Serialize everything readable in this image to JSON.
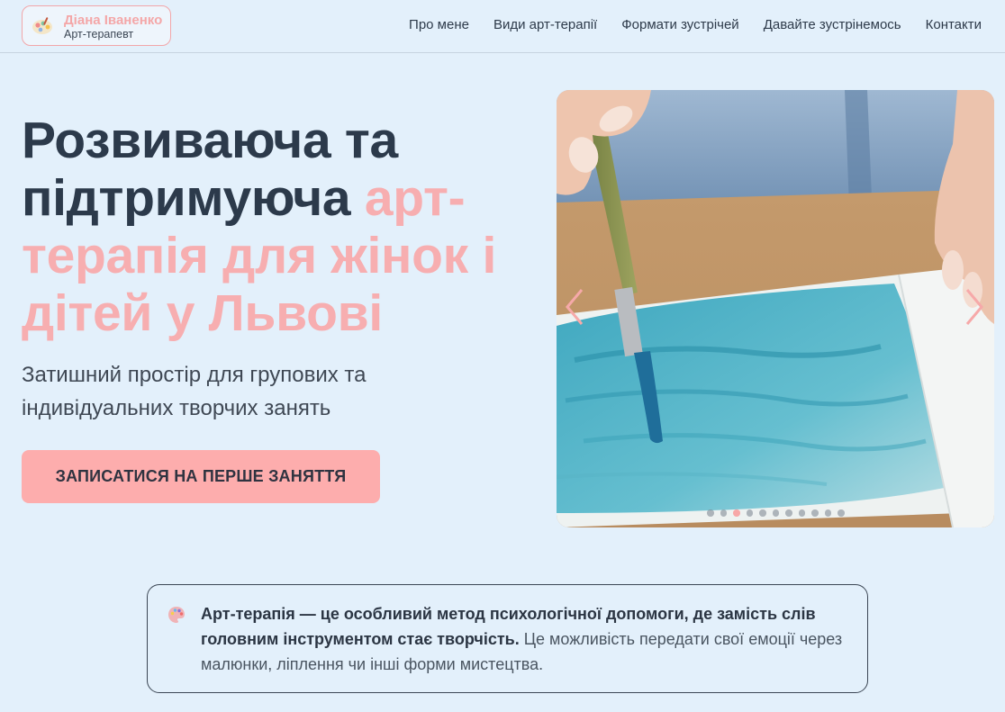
{
  "brand": {
    "name": "Діана Іваненко",
    "role": "Арт-терапевт",
    "logo_icon": "palette-splash-icon"
  },
  "nav": {
    "items": [
      {
        "label": "Про мене"
      },
      {
        "label": "Види арт-терапії"
      },
      {
        "label": "Формати зустрічей"
      },
      {
        "label": "Давайте зустрінемось"
      },
      {
        "label": "Контакти"
      }
    ]
  },
  "hero": {
    "title_plain": "Розвиваюча та підтримуюча",
    "title_accent": "арт-терапія для жінок і дітей у Львові",
    "subtitle": "Затишний простір для групових та індивідуальних творчих занять",
    "cta_label": "ЗАПИСАТИСЯ НА ПЕРШЕ ЗАНЯТТЯ"
  },
  "carousel": {
    "image": "hand-with-brush-painting-watercolor",
    "prev_icon": "chevron-left-icon",
    "next_icon": "chevron-right-icon",
    "slide_count": 11,
    "active_slide": 3
  },
  "info": {
    "icon": "palette-icon",
    "bold_text": "Арт-терапія — це особливий метод психологічної допомоги, де замість слів головним інструментом стає творчість.",
    "text": " Це можливість передати свої емоції через малюнки, ліплення чи інші форми мистецтва."
  },
  "colors": {
    "background": "#e3f0fb",
    "accent": "#f7aeb0",
    "button": "#fdadad",
    "text_dark": "#2c3a4b"
  }
}
